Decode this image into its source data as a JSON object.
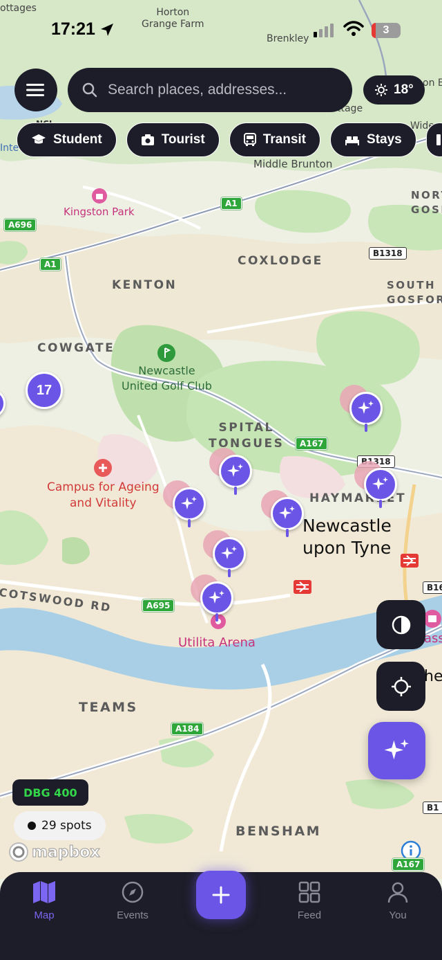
{
  "status_bar": {
    "time": "17:21",
    "battery": "3"
  },
  "search": {
    "placeholder": "Search places, addresses..."
  },
  "weather": {
    "temp": "18°"
  },
  "chips": [
    {
      "label": "Student",
      "icon": "graduation-cap-icon"
    },
    {
      "label": "Tourist",
      "icon": "camera-icon"
    },
    {
      "label": "Transit",
      "icon": "bus-icon"
    },
    {
      "label": "Stays",
      "icon": "bed-icon"
    }
  ],
  "map": {
    "places": {
      "horton": "Horton\nGrange Farm",
      "brenkley": "Brenkley",
      "cottages": "ottages",
      "middle_brunton": "Middle Brunton",
      "kingston_park": "Kingston Park",
      "coxlodge": "COXLODGE",
      "kenton": "KENTON",
      "cowgate": "COWGATE",
      "golf": "Newcastle\nUnited Golf Club",
      "spital": "SPITAL\nTONGUES",
      "campus": "Campus for Ageing\nand Vitality",
      "haymarket": "HAYMARKET",
      "city": "Newcastle\nupon Tyne",
      "cotswood": "COTSWOOD RD",
      "utilita": "Utilita Arena",
      "teams": "TEAMS",
      "bensham": "BENSHAM",
      "north_gosforth": "NORT\nGOSFO",
      "south_gosforth": "SOUTH\nGOSFORT",
      "intl": "Inte",
      "ncl": "NCL",
      "wideo": "Wideo",
      "wi_ttage": "wi\nttage",
      "on_e": "on E",
      "cass": "ass",
      "gateshead_partial": "he"
    },
    "roads": {
      "a1_top": "A1",
      "a696": "A696",
      "a1_left": "A1",
      "b1318_top": "B1318",
      "a167": "A167",
      "b1318_mid": "B1318",
      "b16": "B16",
      "a695": "A695",
      "a184": "A184",
      "b1_bottom": "B1",
      "a167_bottom": "A167"
    },
    "cluster_count": "17",
    "attribution": "mapbox"
  },
  "overlays": {
    "dbg": "DBG 400",
    "spots": "29 spots"
  },
  "tabs": [
    {
      "label": "Map",
      "icon": "map-icon",
      "active": true
    },
    {
      "label": "Events",
      "icon": "compass-icon",
      "active": false
    },
    {
      "label": "Feed",
      "icon": "grid-icon",
      "active": false
    },
    {
      "label": "You",
      "icon": "user-icon",
      "active": false
    }
  ],
  "colors": {
    "accent": "#6a55e6",
    "dark": "#1c1d28",
    "water": "#a9cfe6",
    "park": "#c8e6b7",
    "land": "#eef0e4"
  }
}
